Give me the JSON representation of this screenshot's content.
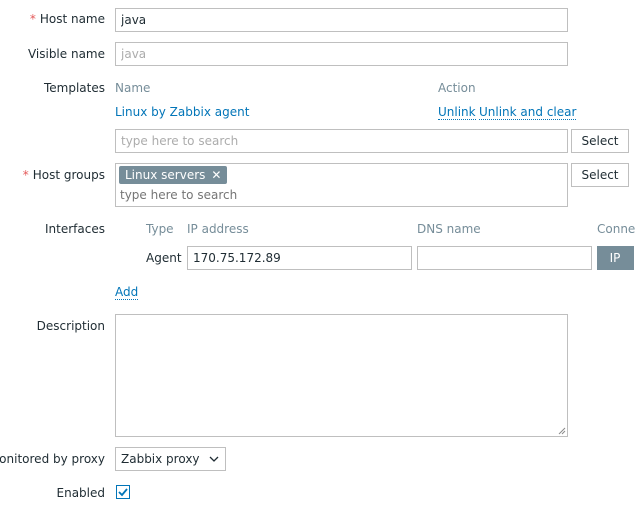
{
  "form": {
    "host_name": {
      "label": "Host name",
      "required": "*",
      "value": "java"
    },
    "visible_name": {
      "label": "Visible name",
      "placeholder": "java"
    },
    "templates": {
      "label": "Templates",
      "col_name": "Name",
      "col_action": "Action",
      "items": [
        {
          "name": "Linux by Zabbix agent",
          "unlink": "Unlink",
          "unlink_clear": "Unlink and clear"
        }
      ],
      "search_placeholder": "type here to search",
      "select_label": "Select"
    },
    "host_groups": {
      "label": "Host groups",
      "required": "*",
      "chip": "Linux servers",
      "chip_remove": "✕",
      "search_placeholder": "type here to search",
      "select_label": "Select"
    },
    "interfaces": {
      "label": "Interfaces",
      "col_type": "Type",
      "col_ip": "IP address",
      "col_dns": "DNS name",
      "col_connect": "Conne",
      "row": {
        "type": "Agent",
        "ip": "170.75.172.89",
        "dns": "",
        "connect_ip": "IP"
      },
      "add_label": "Add"
    },
    "description": {
      "label": "Description",
      "value": ""
    },
    "monitored_by_proxy": {
      "label": "Monitored by proxy",
      "value": "Zabbix proxy"
    },
    "enabled": {
      "label": "Enabled",
      "checked": true
    }
  },
  "colors": {
    "link": "#0275b8",
    "required": "#e45959",
    "chip": "#768d99",
    "border": "#bfbfbf"
  }
}
